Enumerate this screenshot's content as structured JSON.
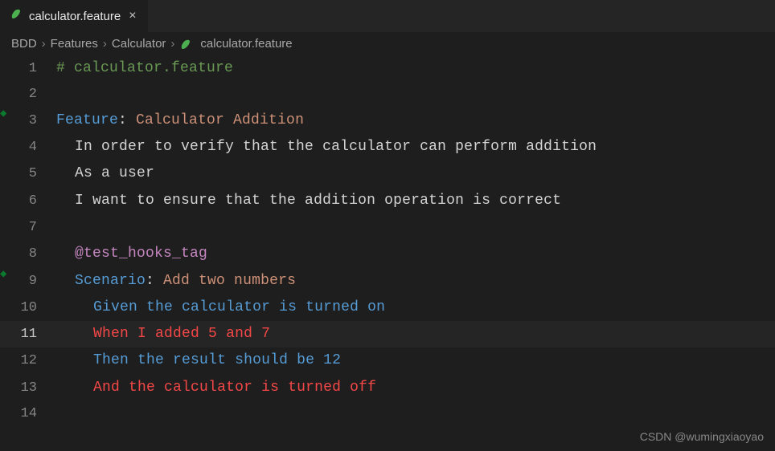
{
  "tab": {
    "label": "calculator.feature"
  },
  "breadcrumbs": [
    "BDD",
    "Features",
    "Calculator",
    "calculator.feature"
  ],
  "lines": {
    "l1": {
      "num": "1",
      "comment": "# calculator.feature"
    },
    "l2": {
      "num": "2"
    },
    "l3": {
      "num": "3",
      "kw": "Feature",
      "colon": ": ",
      "val": "Calculator Addition"
    },
    "l4": {
      "num": "4",
      "txt": "In order to verify that the calculator can perform addition"
    },
    "l5": {
      "num": "5",
      "txt": "As a user"
    },
    "l6": {
      "num": "6",
      "txt": "I want to ensure that the addition operation is correct"
    },
    "l7": {
      "num": "7"
    },
    "l8": {
      "num": "8",
      "tag": "@test_hooks_tag"
    },
    "l9": {
      "num": "9",
      "kw": "Scenario",
      "colon": ": ",
      "val": "Add two numbers"
    },
    "l10": {
      "num": "10",
      "step": "Given ",
      "rest": "the calculator is turned on"
    },
    "l11": {
      "num": "11",
      "step": "When ",
      "rest": "I added 5 and 7"
    },
    "l12": {
      "num": "12",
      "step": "Then ",
      "rest": "the result should be 12"
    },
    "l13": {
      "num": "13",
      "step": "And ",
      "rest": "the calculator is turned off"
    },
    "l14": {
      "num": "14"
    }
  },
  "watermark": "CSDN @wumingxiaoyao"
}
